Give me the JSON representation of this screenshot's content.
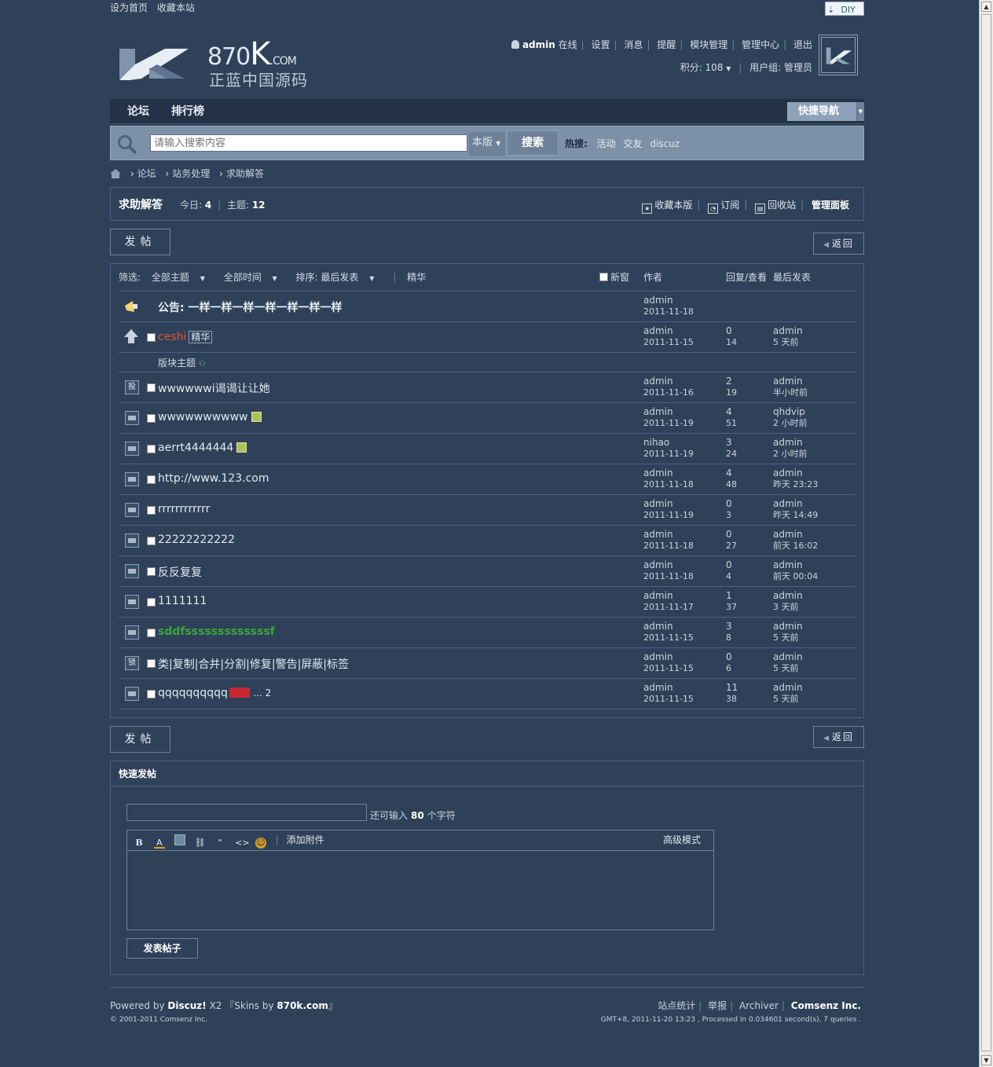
{
  "topbar": {
    "set_home": "设为首页",
    "bookmark": "收藏本站",
    "diy": "DIY"
  },
  "logo": {
    "brand": "870",
    "brand_k": "K",
    "brand_tld": ".COM",
    "slogan": "正蓝中国源码"
  },
  "user": {
    "name": "admin",
    "status": "在线",
    "links": [
      "设置",
      "消息",
      "提醒",
      "模块管理",
      "管理中心",
      "退出"
    ],
    "points": "积分: 108",
    "group": "用户组: 管理员"
  },
  "nav": {
    "items": [
      "论坛",
      "排行榜"
    ],
    "quick_nav": "快捷导航"
  },
  "search": {
    "placeholder": "请输入搜索内容",
    "scope": "本版",
    "button": "搜索",
    "hot_label": "热搜:",
    "hot": [
      "活动",
      "交友",
      "discuz"
    ]
  },
  "breadcrumb": [
    "论坛",
    "站务处理",
    "求助解答"
  ],
  "forum": {
    "name": "求助解答",
    "today_label": "今日:",
    "today": "4",
    "threads_label": "主题:",
    "threads": "12",
    "actions": [
      "收藏本版",
      "订阅",
      "回收站",
      "管理面板"
    ]
  },
  "buttons": {
    "post": "发帖",
    "back": "返回"
  },
  "list": {
    "filter_label": "筛选:",
    "filters": [
      "全部主题",
      "全部时间",
      "排序: 最后发表",
      "精华"
    ],
    "col_new": "新窗",
    "col_author": "作者",
    "col_reply": "回复/查看",
    "col_last": "最后发表",
    "announce": {
      "title": "公告: 一样一样一样一样一样一样一样",
      "author": "admin",
      "date": "2011-11-18"
    },
    "sticky": {
      "title": "ceshi",
      "tag": "精华",
      "author": "admin",
      "date": "2011-11-15",
      "replies": "0",
      "views": "14",
      "last_user": "admin",
      "last_time": "5 天前"
    },
    "section_label": "版块主题",
    "threads": [
      {
        "icon": "投",
        "title": "wwwwwwi谒谒让让她",
        "img": false,
        "author": "admin",
        "date": "2011-11-16",
        "replies": "2",
        "views": "19",
        "last_user": "admin",
        "last_time": "半小时前",
        "color": ""
      },
      {
        "icon": "",
        "title": "wwwwwwwwww",
        "img": true,
        "author": "admin",
        "date": "2011-11-19",
        "replies": "4",
        "views": "51",
        "last_user": "qhdvip",
        "last_time": "2 小时前",
        "color": ""
      },
      {
        "icon": "",
        "title": "aerrt4444444",
        "img": true,
        "author": "nihao",
        "date": "2011-11-19",
        "replies": "3",
        "views": "24",
        "last_user": "admin",
        "last_time": "2 小时前",
        "color": ""
      },
      {
        "icon": "",
        "title": "http://www.123.com",
        "img": false,
        "author": "admin",
        "date": "2011-11-18",
        "replies": "4",
        "views": "48",
        "last_user": "admin",
        "last_time": "昨天 23:23",
        "color": ""
      },
      {
        "icon": "",
        "title": "rrrrrrrrrrrr",
        "img": false,
        "author": "admin",
        "date": "2011-11-19",
        "replies": "0",
        "views": "3",
        "last_user": "admin",
        "last_time": "昨天 14:49",
        "color": ""
      },
      {
        "icon": "",
        "title": "22222222222",
        "img": false,
        "author": "admin",
        "date": "2011-11-18",
        "replies": "0",
        "views": "27",
        "last_user": "admin",
        "last_time": "前天 16:02",
        "color": ""
      },
      {
        "icon": "",
        "title": "反反复复",
        "img": false,
        "author": "admin",
        "date": "2011-11-18",
        "replies": "0",
        "views": "4",
        "last_user": "admin",
        "last_time": "前天 00:04",
        "color": ""
      },
      {
        "icon": "",
        "title": "1111111",
        "img": false,
        "author": "admin",
        "date": "2011-11-17",
        "replies": "1",
        "views": "37",
        "last_user": "admin",
        "last_time": "3 天前",
        "color": ""
      },
      {
        "icon": "",
        "title": "sddfsssssssssssssf",
        "img": false,
        "author": "admin",
        "date": "2011-11-15",
        "replies": "3",
        "views": "8",
        "last_user": "admin",
        "last_time": "5 天前",
        "color": "#3da33d"
      },
      {
        "icon": "锁",
        "title": "类|复制|合并|分割|修复|警告|屏蔽|标签",
        "img": false,
        "author": "admin",
        "date": "2011-11-15",
        "replies": "0",
        "views": "6",
        "last_user": "admin",
        "last_time": "5 天前",
        "color": ""
      },
      {
        "icon": "",
        "title": "qqqqqqqqqq",
        "img": false,
        "hot": true,
        "pages": "... 2",
        "author": "admin",
        "date": "2011-11-15",
        "replies": "11",
        "views": "38",
        "last_user": "admin",
        "last_time": "5 天前",
        "color": ""
      }
    ]
  },
  "quick_post": {
    "title": "快速发帖",
    "limit_prefix": "还可输入",
    "limit_num": "80",
    "limit_suffix": "个字符",
    "attach": "添加附件",
    "advanced": "高级模式",
    "submit": "发表帖子"
  },
  "footer": {
    "powered": "Powered by",
    "product": "Discuz!",
    "version": "X2",
    "skin_prefix": "『Skins by",
    "skin_site": "870k.com",
    "skin_suffix": "』",
    "copyright": "© 2001-2011 Comsenz Inc.",
    "links": [
      "站点统计",
      "举报",
      "Archiver"
    ],
    "company": "Comsenz Inc.",
    "info": "GMT+8, 2011-11-20 13:23 , Processed in 0.034601 second(s), 7 queries ."
  },
  "colors": {
    "bg": "#2e4159",
    "nav": "#233246",
    "search": "#7c91a8",
    "sticky_title": "#e8532b",
    "hot_tag": "#c9272f"
  }
}
